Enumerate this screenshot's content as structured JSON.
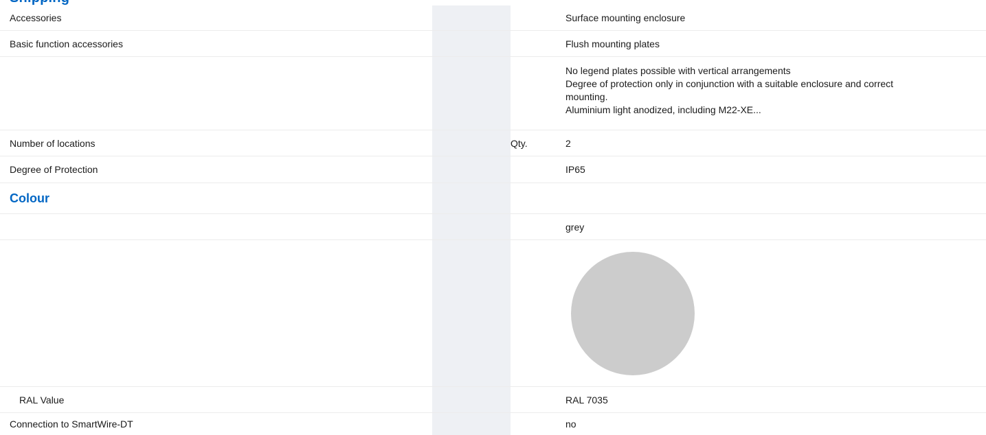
{
  "header": {
    "title": "Shipping"
  },
  "colors": {
    "accent": "#0066c4",
    "swatch": "#cccccc",
    "column_shade": "#eef0f4"
  },
  "rows": {
    "accessories": {
      "label": "Accessories",
      "value": "Surface mounting enclosure"
    },
    "basic_accessories": {
      "label": "Basic function accessories",
      "value": "Flush mounting plates"
    },
    "notes": {
      "lines": [
        "No legend plates possible with vertical arrangements",
        "Degree of protection only in conjunction with a suitable enclosure and correct",
        "mounting.",
        "Aluminium light anodized, including M22-XE..."
      ]
    },
    "locations": {
      "label": "Number of locations",
      "unit": "Qty.",
      "value": "2"
    },
    "protection": {
      "label": "Degree of Protection",
      "value": "IP65"
    },
    "colour_section": {
      "title": "Colour"
    },
    "colour_name": {
      "value": "grey"
    },
    "swatch": {
      "icon": "colour-swatch-circle"
    },
    "ral": {
      "label": "RAL Value",
      "value": "RAL 7035"
    },
    "smartwire": {
      "label": "Connection to SmartWire-DT",
      "value": "no"
    }
  }
}
